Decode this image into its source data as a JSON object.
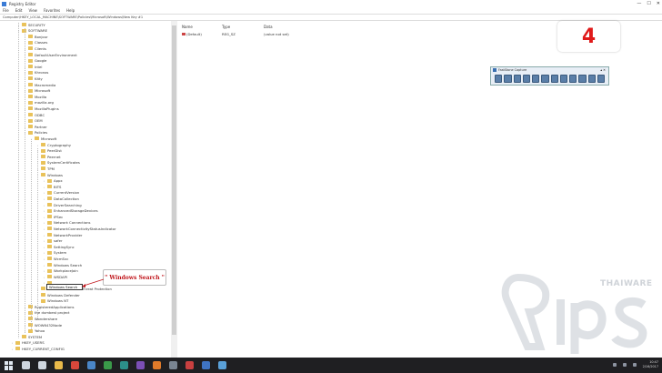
{
  "window": {
    "title": "Registry Editor",
    "minimize": "—",
    "maximize": "☐",
    "close": "✕"
  },
  "menu": [
    "File",
    "Edit",
    "View",
    "Favorites",
    "Help"
  ],
  "address": "Computer\\HKEY_LOCAL_MACHINE\\SOFTWARE\\Policies\\Microsoft\\Windows\\New Key #1",
  "tree": {
    "items": [
      {
        "label": "SECURITY",
        "depth": 2
      },
      {
        "label": "SOFTWARE",
        "depth": 2
      },
      {
        "label": "Bonjour",
        "depth": 3
      },
      {
        "label": "Classes",
        "depth": 3
      },
      {
        "label": "Clients",
        "depth": 3
      },
      {
        "label": "DefaultUserEnvironment",
        "depth": 3
      },
      {
        "label": "Google",
        "depth": 3
      },
      {
        "label": "Intel",
        "depth": 3
      },
      {
        "label": "Khronos",
        "depth": 3
      },
      {
        "label": "Kitty",
        "depth": 3
      },
      {
        "label": "Macromedia",
        "depth": 3
      },
      {
        "label": "Microsoft",
        "depth": 3
      },
      {
        "label": "Mozilla",
        "depth": 3
      },
      {
        "label": "mozilla.org",
        "depth": 3
      },
      {
        "label": "MozillaPlugins",
        "depth": 3
      },
      {
        "label": "ODBC",
        "depth": 3
      },
      {
        "label": "OEM",
        "depth": 3
      },
      {
        "label": "Partner",
        "depth": 3
      },
      {
        "label": "Policies",
        "depth": 3
      },
      {
        "label": "Microsoft",
        "depth": 4
      },
      {
        "label": "Cryptography",
        "depth": 5
      },
      {
        "label": "PeerDist",
        "depth": 5
      },
      {
        "label": "Peernet",
        "depth": 5
      },
      {
        "label": "SystemCertificates",
        "depth": 5
      },
      {
        "label": "TPM",
        "depth": 5
      },
      {
        "label": "Windows",
        "depth": 5
      },
      {
        "label": "Appx",
        "depth": 6
      },
      {
        "label": "BITS",
        "depth": 6
      },
      {
        "label": "CurrentVersion",
        "depth": 6
      },
      {
        "label": "DataCollection",
        "depth": 6
      },
      {
        "label": "DriverSearching",
        "depth": 6
      },
      {
        "label": "EnhancedStorageDevices",
        "depth": 6
      },
      {
        "label": "IPSec",
        "depth": 6
      },
      {
        "label": "Network Connections",
        "depth": 6
      },
      {
        "label": "NetworkConnectivityStatusIndicator",
        "depth": 6
      },
      {
        "label": "NetworkProvider",
        "depth": 6
      },
      {
        "label": "safer",
        "depth": 6
      },
      {
        "label": "SettingSync",
        "depth": 6
      },
      {
        "label": "System",
        "depth": 6
      },
      {
        "label": "WcmSvc",
        "depth": 6
      },
      {
        "label": "Windows Search",
        "depth": 6
      },
      {
        "label": "WorkplaceJoin",
        "depth": 6
      },
      {
        "label": "WSDAPI",
        "depth": 6
      },
      {
        "label": "",
        "depth": 6
      },
      {
        "label": "Windows Advanced Threat Protection",
        "depth": 5
      },
      {
        "label": "Windows Defender",
        "depth": 5
      },
      {
        "label": "Windows NT",
        "depth": 5
      },
      {
        "label": "RegisteredApplications",
        "depth": 3
      },
      {
        "label": "the dumbest project",
        "depth": 3
      },
      {
        "label": "Wondershare",
        "depth": 3
      },
      {
        "label": "WOW6432Node",
        "depth": 3
      },
      {
        "label": "Yahoo",
        "depth": 3
      },
      {
        "label": "SYSTEM",
        "depth": 2
      },
      {
        "label": "HKEY_USERS",
        "depth": 1
      },
      {
        "label": "HKEY_CURRENT_CONFIG",
        "depth": 1
      }
    ],
    "rename_value": "Windows Search"
  },
  "values_pane": {
    "headers": {
      "name": "Name",
      "type": "Type",
      "data": "Data"
    },
    "rows": [
      {
        "name": "(Default)",
        "type": "REG_SZ",
        "data": "(value not set)"
      }
    ]
  },
  "step_badge": "4",
  "callout": "\" Windows Search \"",
  "floating_toolbar": {
    "title": "FastStone Capture",
    "controls": "▴ ✕",
    "tools": [
      "capture-window",
      "capture-object",
      "capture-rect",
      "capture-freehand",
      "capture-fullscreen",
      "capture-scroll",
      "capture-fixed",
      "capture-video",
      "record-screen",
      "open-editor",
      "settings",
      "menu"
    ]
  },
  "watermark": {
    "brand": "THAIWARE",
    "logo": "tips"
  },
  "taskbar": {
    "apps": [
      {
        "name": "search-icon",
        "color": "#cfd6df"
      },
      {
        "name": "task-view-icon",
        "color": "#cfd6df"
      },
      {
        "name": "file-explorer-icon",
        "color": "#e9b94a"
      },
      {
        "name": "chrome-icon",
        "color": "#d9473b"
      },
      {
        "name": "store-icon",
        "color": "#4a86c8"
      },
      {
        "name": "app-green-icon",
        "color": "#3a9a4a"
      },
      {
        "name": "app-teal-icon",
        "color": "#2c8f8a"
      },
      {
        "name": "app-purple-icon",
        "color": "#7b4fb5"
      },
      {
        "name": "app-orange-icon",
        "color": "#e07b2a"
      },
      {
        "name": "app-gray-icon",
        "color": "#7a8592"
      },
      {
        "name": "app-red-icon",
        "color": "#c94040"
      },
      {
        "name": "app-blue-icon",
        "color": "#3f74c4"
      },
      {
        "name": "regedit-icon",
        "color": "#5aa0d8"
      }
    ],
    "time": "10:47",
    "date": "2/16/2017"
  }
}
